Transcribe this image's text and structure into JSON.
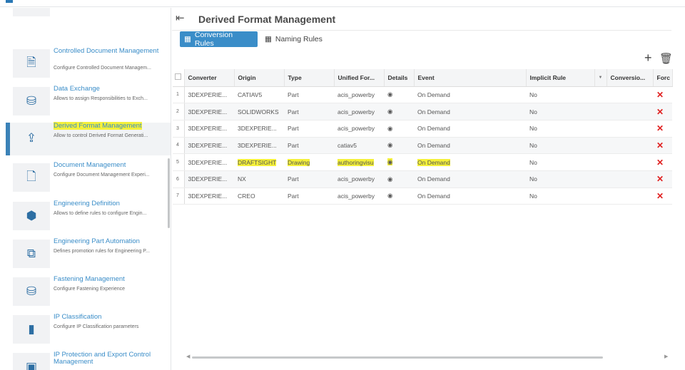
{
  "sidebar": {
    "items": [
      {
        "title": "",
        "desc": "",
        "icon": "settings-icon"
      },
      {
        "title": "Controlled Document Management",
        "desc": "Configure Controlled Document Managem...",
        "icon": "controlled-document-icon"
      },
      {
        "title": "Data Exchange",
        "desc": "Allows to assign Responsibilities to Exch...",
        "icon": "data-exchange-icon"
      },
      {
        "title": "Derived Format Management",
        "desc": "Allow to control Derived Format Generati...",
        "icon": "upload-icon"
      },
      {
        "title": "Document Management",
        "desc": "Configure Document Management Experi...",
        "icon": "document-icon"
      },
      {
        "title": "Engineering Definition",
        "desc": "Allows to define rules to configure Engin...",
        "icon": "engineering-definition-icon"
      },
      {
        "title": "Engineering Part Automation",
        "desc": "Defines promotion rules for Engineering P...",
        "icon": "flowchart-icon"
      },
      {
        "title": "Fastening Management",
        "desc": "Configure Fastening Experience",
        "icon": "fastening-icon"
      },
      {
        "title": "IP Classification",
        "desc": "Configure IP Classification parameters",
        "icon": "ip-classification-icon"
      },
      {
        "title": "IP Protection and Export Control Management",
        "desc": "",
        "icon": "ip-protection-icon"
      }
    ]
  },
  "main": {
    "title": "Derived Format Management",
    "tabs": [
      {
        "label": "Conversion Rules"
      },
      {
        "label": "Naming Rules"
      }
    ],
    "add": "+",
    "delete": "🗑"
  },
  "table": {
    "columns": [
      "Converter",
      "Origin",
      "Type",
      "Unified For...",
      "Details",
      "Event",
      "Implicit Rule",
      "",
      "Conversio...",
      "Forc"
    ],
    "rows": [
      [
        "1",
        "3DEXPERIE...",
        "CATIAV5",
        "Part",
        "acis_powerby",
        "On Demand",
        "No"
      ],
      [
        "2",
        "3DEXPERIE...",
        "SOLIDWORKS",
        "Part",
        "acis_powerby",
        "On Demand",
        "No"
      ],
      [
        "3",
        "3DEXPERIE...",
        "3DEXPERIE...",
        "Part",
        "acis_powerby",
        "On Demand",
        "No"
      ],
      [
        "4",
        "3DEXPERIE...",
        "3DEXPERIE...",
        "Part",
        "catiav5",
        "On Demand",
        "No"
      ],
      [
        "5",
        "3DEXPERIE...",
        "DRAFTSIGHT",
        "Drawing",
        "authoringvisu",
        "On Demand",
        "No"
      ],
      [
        "6",
        "3DEXPERIE...",
        "NX",
        "Part",
        "acis_powerby",
        "On Demand",
        "No"
      ],
      [
        "7",
        "3DEXPERIE...",
        "CREO",
        "Part",
        "acis_powerby",
        "On Demand",
        "No"
      ]
    ]
  },
  "colors": {
    "accent": "#3a8dc8",
    "highlight": "#f4f03a",
    "delete": "#e02020"
  }
}
